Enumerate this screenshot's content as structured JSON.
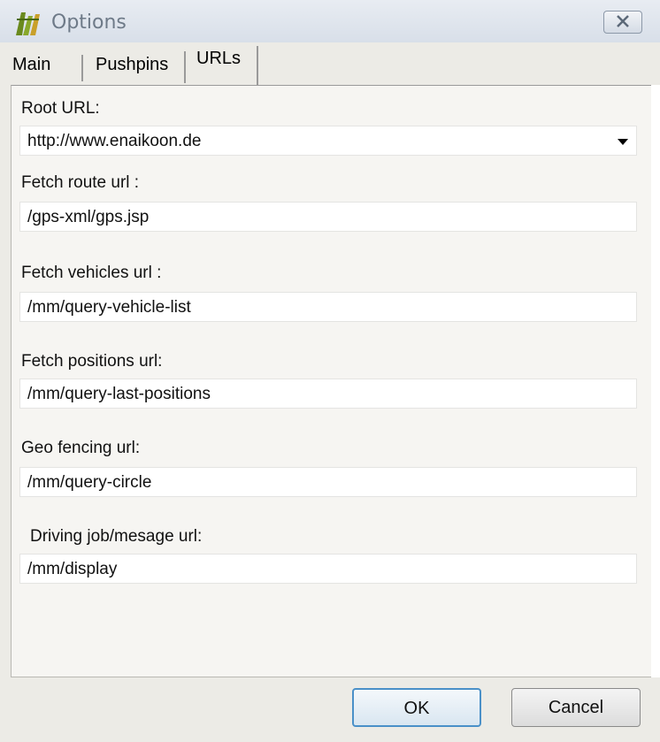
{
  "window": {
    "title": "Options",
    "icon": "app-logo-icon",
    "close_icon": "close-icon"
  },
  "tabs": [
    {
      "label": "Main",
      "active": false
    },
    {
      "label": "Pushpins",
      "active": false
    },
    {
      "label": "URLs",
      "active": true
    }
  ],
  "form": {
    "root_url": {
      "label": "Root URL:",
      "value": "http://www.enaikoon.de"
    },
    "fetch_route": {
      "label": "Fetch route url :",
      "value": "/gps-xml/gps.jsp"
    },
    "fetch_vehicles": {
      "label": "Fetch vehicles url :",
      "value": "/mm/query-vehicle-list"
    },
    "fetch_positions": {
      "label": "Fetch positions url:",
      "value": "/mm/query-last-positions"
    },
    "geo_fencing": {
      "label": "Geo fencing url:",
      "value": "/mm/query-circle"
    },
    "driving_job": {
      "label": "Driving job/mesage url:",
      "value": "/mm/display"
    }
  },
  "buttons": {
    "ok": "OK",
    "cancel": "Cancel"
  },
  "colors": {
    "ok_border": "#4a90c8",
    "title_text": "#6e7a88"
  }
}
